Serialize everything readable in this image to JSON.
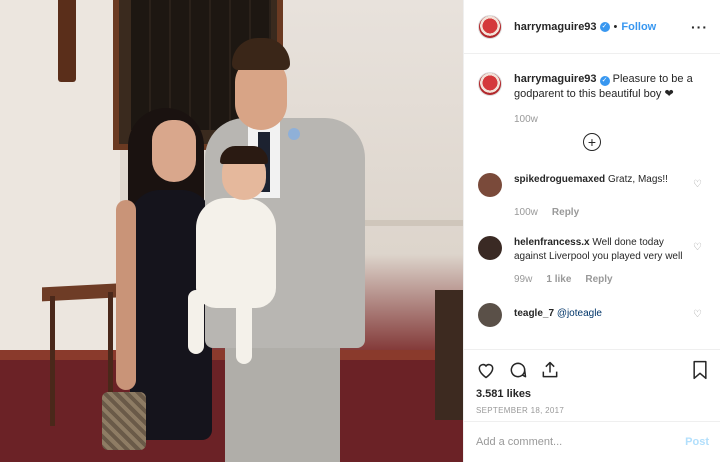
{
  "post": {
    "username": "harrymaguire93",
    "dot": "•",
    "follow_label": "Follow",
    "more_label": "···",
    "caption_user": "harrymaguire93",
    "caption_text": "Pleasure to be a godparent to this beautiful boy ❤",
    "caption_time": "100w",
    "load_more_icon": "plus-circle-icon"
  },
  "comments": [
    {
      "user": "spikedroguemaxed",
      "text": "Gratz, Mags!!",
      "time": "100w",
      "likes": "",
      "reply": "Reply",
      "avatar_color": "#7a4a3a"
    },
    {
      "user": "helenfrancess.x",
      "text": "Well done today against Liverpool you played very well",
      "time": "99w",
      "likes": "1 like",
      "reply": "Reply",
      "avatar_color": "#3a2a24"
    },
    {
      "user": "teagle_7",
      "text": "@joteagle",
      "avatar_color": "#5a5048"
    }
  ],
  "actions": {
    "likes": "3.581 likes",
    "date": "SEPTEMBER 18, 2017",
    "comment_placeholder": "Add a comment...",
    "post_label": "Post"
  },
  "colors": {
    "accent": "#3897f0",
    "muted": "#999999",
    "post_disabled": "#b2dffc"
  }
}
